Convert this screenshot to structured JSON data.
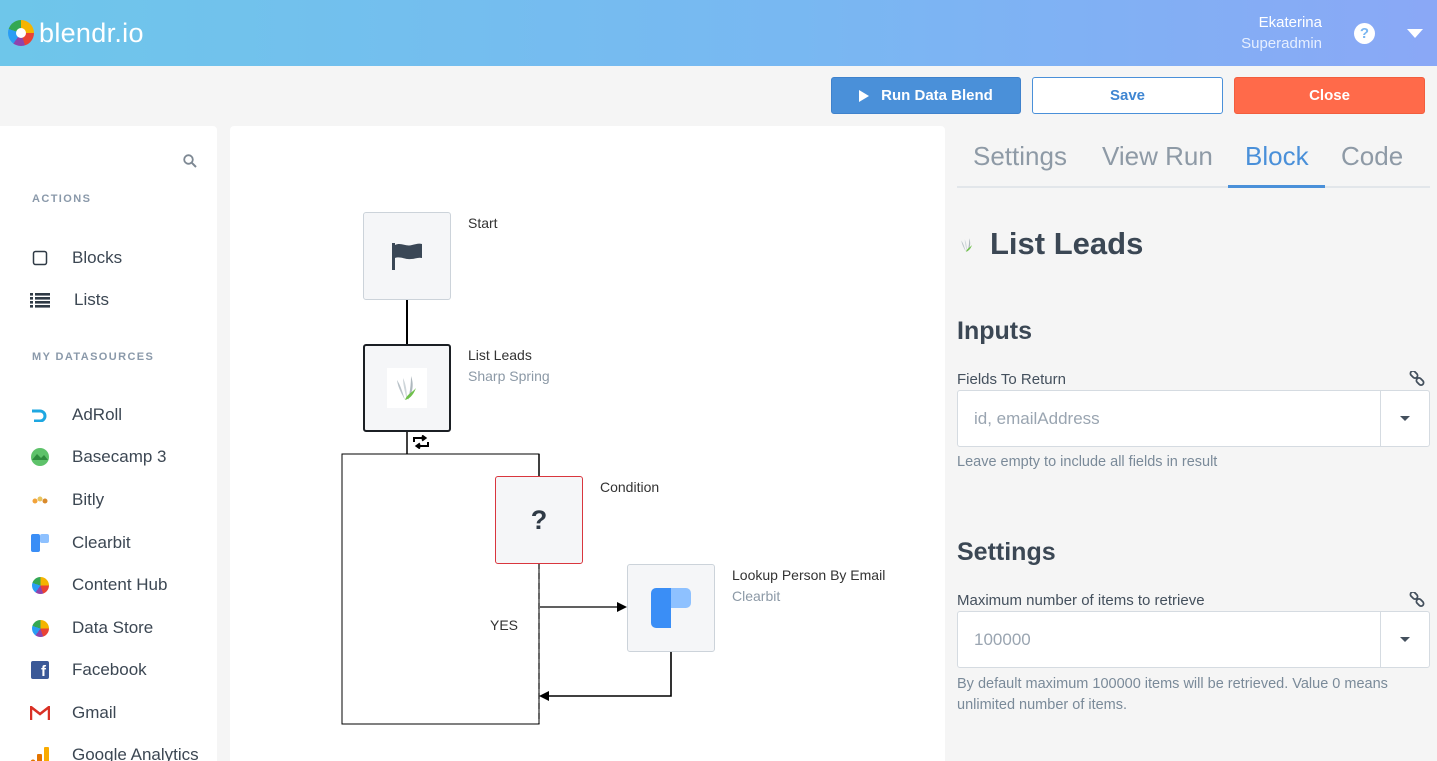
{
  "app": {
    "logo_text": "blendr.io"
  },
  "user": {
    "name": "Ekaterina",
    "role": "Superadmin"
  },
  "toolbar": {
    "run_label": "Run Data Blend",
    "save_label": "Save",
    "close_label": "Close"
  },
  "sidebar": {
    "actions_label": "ACTIONS",
    "actions": [
      {
        "label": "Blocks",
        "icon": "square-icon"
      },
      {
        "label": "Lists",
        "icon": "list-icon"
      }
    ],
    "datasources_label": "MY DATASOURCES",
    "datasources": [
      {
        "label": "AdRoll",
        "icon": "adroll-icon"
      },
      {
        "label": "Basecamp 3",
        "icon": "basecamp-icon"
      },
      {
        "label": "Bitly",
        "icon": "bitly-icon"
      },
      {
        "label": "Clearbit",
        "icon": "clearbit-icon"
      },
      {
        "label": "Content Hub",
        "icon": "blendr-icon"
      },
      {
        "label": "Data Store",
        "icon": "blendr-icon"
      },
      {
        "label": "Facebook",
        "icon": "facebook-icon"
      },
      {
        "label": "Gmail",
        "icon": "gmail-icon"
      },
      {
        "label": "Google Analytics",
        "icon": "google-analytics-icon"
      }
    ]
  },
  "flow": {
    "start": {
      "title": "Start"
    },
    "list_leads": {
      "title": "List Leads",
      "subtitle": "Sharp Spring"
    },
    "condition": {
      "title": "Condition",
      "glyph": "?"
    },
    "yes_label": "YES",
    "lookup": {
      "title": "Lookup Person By Email",
      "subtitle": "Clearbit"
    }
  },
  "panel": {
    "tabs": [
      "Settings",
      "View Run",
      "Block",
      "Code"
    ],
    "active_tab": "Block",
    "block_title": "List Leads",
    "inputs_heading": "Inputs",
    "fields_label": "Fields To Return",
    "fields_placeholder": "id, emailAddress",
    "fields_hint": "Leave empty to include all fields in result",
    "settings_heading": "Settings",
    "max_label": "Maximum number of items to retrieve",
    "max_placeholder": "100000",
    "max_hint": "By default maximum 100000 items will be retrieved. Value 0 means unlimited number of items."
  },
  "colors": {
    "accent": "#4a90d9",
    "danger": "#ff6a4a",
    "condition_border": "#d9363e"
  }
}
